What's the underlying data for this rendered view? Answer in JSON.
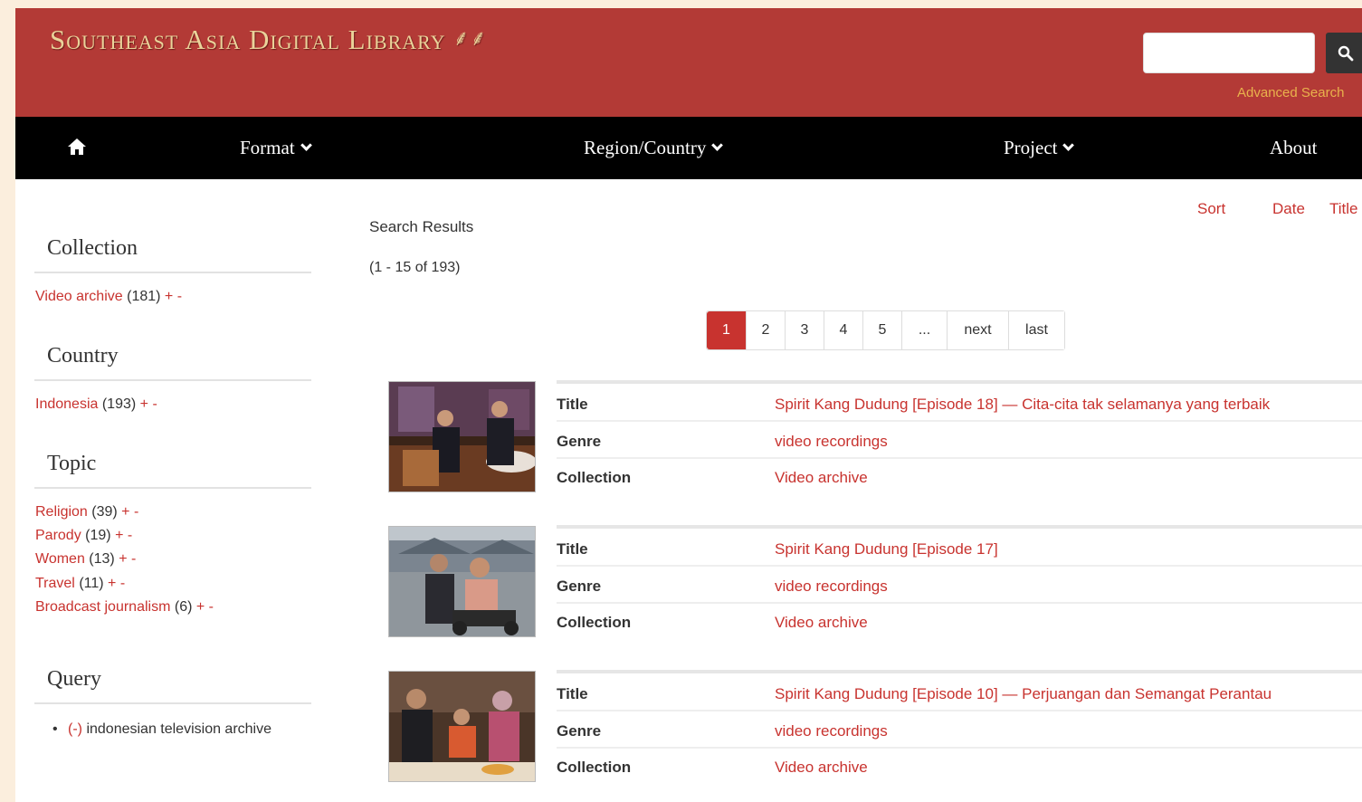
{
  "header": {
    "site_title": "Southeast Asia Digital Library",
    "logo_glyph": "⸙⸙",
    "search_placeholder": "",
    "search_button_icon": "search-icon",
    "advanced_search": "Advanced Search"
  },
  "nav": {
    "home_icon": "home-icon",
    "format": "Format",
    "region": "Region/Country",
    "project": "Project",
    "about": "About"
  },
  "sidebar": {
    "collection": {
      "title": "Collection",
      "items": [
        {
          "label": "Video archive",
          "count": "(181)",
          "plus": "+",
          "minus": "-"
        }
      ]
    },
    "country": {
      "title": "Country",
      "items": [
        {
          "label": "Indonesia",
          "count": "(193)",
          "plus": "+",
          "minus": "-"
        }
      ]
    },
    "topic": {
      "title": "Topic",
      "items": [
        {
          "label": "Religion",
          "count": "(39)",
          "plus": "+",
          "minus": "-"
        },
        {
          "label": "Parody",
          "count": "(19)",
          "plus": "+",
          "minus": "-"
        },
        {
          "label": "Women",
          "count": "(13)",
          "plus": "+",
          "minus": "-"
        },
        {
          "label": "Travel",
          "count": "(11)",
          "plus": "+",
          "minus": "-"
        },
        {
          "label": "Broadcast journalism",
          "count": "(6)",
          "plus": "+",
          "minus": "-"
        }
      ]
    },
    "query": {
      "title": "Query",
      "bullet": "•",
      "remove": "(-)",
      "term": "indonesian television archive"
    }
  },
  "results": {
    "title": "Search Results",
    "count": "(1 - 15 of 193)",
    "sort": {
      "label": "Sort",
      "date": "Date",
      "title": "Title"
    },
    "pagination": [
      "1",
      "2",
      "3",
      "4",
      "5",
      "...",
      "next",
      "last"
    ],
    "field_labels": {
      "title": "Title",
      "genre": "Genre",
      "collection": "Collection"
    },
    "items": [
      {
        "title": "Spirit Kang Dudung [Episode 18] — Cita-cita tak selamanya yang terbaik",
        "genre": "video recordings",
        "collection": "Video archive"
      },
      {
        "title": "Spirit Kang Dudung [Episode 17]",
        "genre": "video recordings",
        "collection": "Video archive"
      },
      {
        "title": "Spirit Kang Dudung [Episode 10] — Perjuangan dan Semangat Perantau",
        "genre": "video recordings",
        "collection": "Video archive"
      }
    ]
  },
  "colors": {
    "header_red": "#b33a36",
    "link_red": "#c8332f",
    "logo_gold": "#ead39a",
    "advanced_search_orange": "#e9b24c",
    "nav_black": "#000000"
  }
}
